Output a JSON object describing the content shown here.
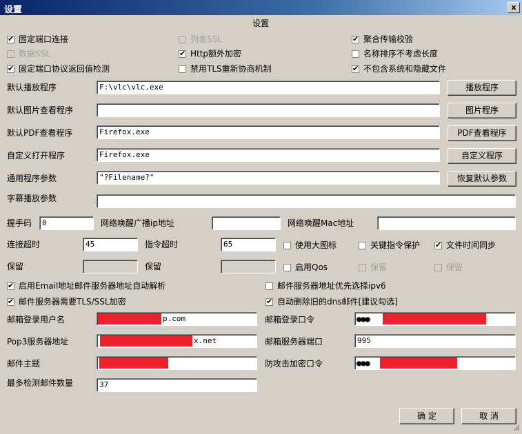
{
  "window": {
    "title": "设置",
    "close_glyph": "x"
  },
  "dialog": {
    "heading": "设置"
  },
  "checks": {
    "fixed_port": {
      "label": "固定端口连接",
      "checked": true
    },
    "list_ssl": {
      "label": "列表SSL",
      "checked": false,
      "disabled": true
    },
    "aggregate_check": {
      "label": "聚合传输校验",
      "checked": true
    },
    "data_ssl": {
      "label": "数据SSL",
      "checked": false,
      "disabled": true
    },
    "http_extra": {
      "label": "Http额外加密",
      "checked": true
    },
    "name_sort": {
      "label": "名称排序不考虑长度",
      "checked": false
    },
    "fixed_port_check": {
      "label": "固定端口协议返回值检测",
      "checked": true
    },
    "disable_tls": {
      "label": "禁用TLS重新协商机制",
      "checked": false
    },
    "no_system_files": {
      "label": "不包含系统和隐藏文件",
      "checked": true
    },
    "big_icon": {
      "label": "使用大图标",
      "checked": false
    },
    "cmd_protect": {
      "label": "关键指令保护",
      "checked": false
    },
    "time_sync": {
      "label": "文件时间同步",
      "checked": true
    },
    "enable_qos": {
      "label": "启用Qos",
      "checked": false
    },
    "reserve1": {
      "label": "保留",
      "checked": false,
      "disabled": true
    },
    "reserve2": {
      "label": "保留",
      "checked": false,
      "disabled": true
    },
    "email_parse": {
      "label": "启用Email地址邮件服务器地址自动解析",
      "checked": true
    },
    "ipv6": {
      "label": "邮件服务器地址优先选择ipv6",
      "checked": false
    },
    "tls_ssl": {
      "label": "邮件服务器需要TLS/SSL加密",
      "checked": true
    },
    "auto_delete": {
      "label": "自动删除旧的dns邮件[建议勾选]",
      "checked": true
    }
  },
  "programs": {
    "player": {
      "label": "默认播放程序",
      "value": "F:\\vlc\\vlc.exe",
      "button": "播放程序"
    },
    "image": {
      "label": "默认图片查看程序",
      "value": "",
      "button": "图片程序"
    },
    "pdf": {
      "label": "默认PDF查看程序",
      "value": "Firefox.exe",
      "button": "PDF查看程序"
    },
    "custom": {
      "label": "自定义打开程序",
      "value": "Firefox.exe",
      "button": "自定义程序"
    },
    "params": {
      "label": "通用程序参数",
      "value": "\"?Filename?\"",
      "button": "恢复默认参数"
    },
    "subtitle": {
      "label": "字幕播放参数",
      "value": ""
    }
  },
  "net": {
    "handshake_label": "握手码",
    "handshake_value": "0",
    "wake_ip_label": "网络唤醒广播ip地址",
    "wake_ip_value": "",
    "wake_mac_label": "网络唤醒Mac地址",
    "wake_mac_value": "",
    "conn_timeout_label": "连接超时",
    "conn_timeout_value": "45",
    "cmd_timeout_label": "指令超时",
    "cmd_timeout_value": "65",
    "reserve_a_label": "保留",
    "reserve_b_label": "保留"
  },
  "mail": {
    "user_label": "邮箱登录用户名",
    "user_suffix": "p.com",
    "password_label": "邮箱登录口令",
    "password_dots": "●●●",
    "pop3_label": "Pop3服务器地址",
    "pop3_suffix": "x.net",
    "port_label": "邮箱服务器端口",
    "port_value": "995",
    "subject_label": "邮件主题",
    "anti_label": "防攻击加密口令",
    "anti_dots": "●●●",
    "max_label": "最多检测邮件数量",
    "max_value": "37"
  },
  "buttons": {
    "ok": "确 定",
    "cancel": "取 消"
  }
}
